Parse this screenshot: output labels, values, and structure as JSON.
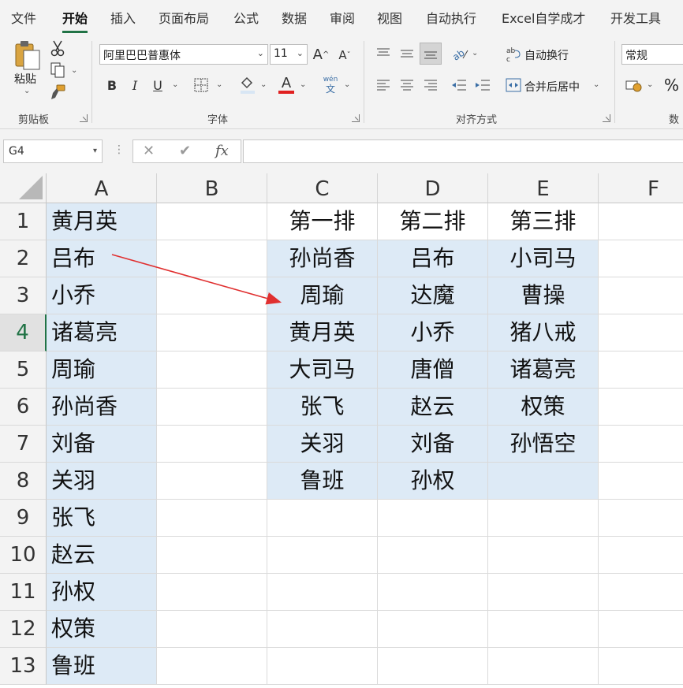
{
  "menu": {
    "tabs": [
      "文件",
      "开始",
      "插入",
      "页面布局",
      "公式",
      "数据",
      "审阅",
      "视图",
      "自动执行",
      "Excel自学成才",
      "开发工具"
    ],
    "active_tab": "开始"
  },
  "ribbon": {
    "clipboard": {
      "paste": "粘贴",
      "group": "剪贴板"
    },
    "font": {
      "name": "阿里巴巴普惠体",
      "size": "11",
      "bold": "B",
      "italic": "I",
      "underline": "U",
      "pinyin_top": "wén",
      "pinyin_bottom": "文",
      "group": "字体",
      "font_color": "#e02020"
    },
    "alignment": {
      "wrap": "自动换行",
      "merge": "合并后居中",
      "group": "对齐方式"
    },
    "number": {
      "format": "常规",
      "percent": "%",
      "group": "数"
    }
  },
  "formula_bar": {
    "name_box": "G4",
    "cancel": "✕",
    "confirm": "✔",
    "fx": "fx",
    "formula": ""
  },
  "sheet": {
    "columns": [
      "A",
      "B",
      "C",
      "D",
      "E",
      "F"
    ],
    "rows": [
      "1",
      "2",
      "3",
      "4",
      "5",
      "6",
      "7",
      "8",
      "9",
      "10",
      "11",
      "12",
      "13"
    ],
    "active_row": "4",
    "column_a": [
      "黄月英",
      "吕布",
      "小乔",
      "诸葛亮",
      "周瑜",
      "孙尚香",
      "刘备",
      "关羽",
      "张飞",
      "赵云",
      "孙权",
      "权策",
      "鲁班"
    ],
    "headers": [
      "第一排",
      "第二排",
      "第三排"
    ],
    "column_c": [
      "孙尚香",
      "周瑜",
      "黄月英",
      "大司马",
      "张飞",
      "关羽",
      "鲁班"
    ],
    "column_d": [
      "吕布",
      "达魔",
      "小乔",
      "唐僧",
      "赵云",
      "刘备",
      "孙权"
    ],
    "column_e": [
      "小司马",
      "曹操",
      "猪八戒",
      "诸葛亮",
      "权策",
      "孙悟空",
      ""
    ],
    "fill_color": "#ddeaf6",
    "arrow_color": "#e03030"
  }
}
